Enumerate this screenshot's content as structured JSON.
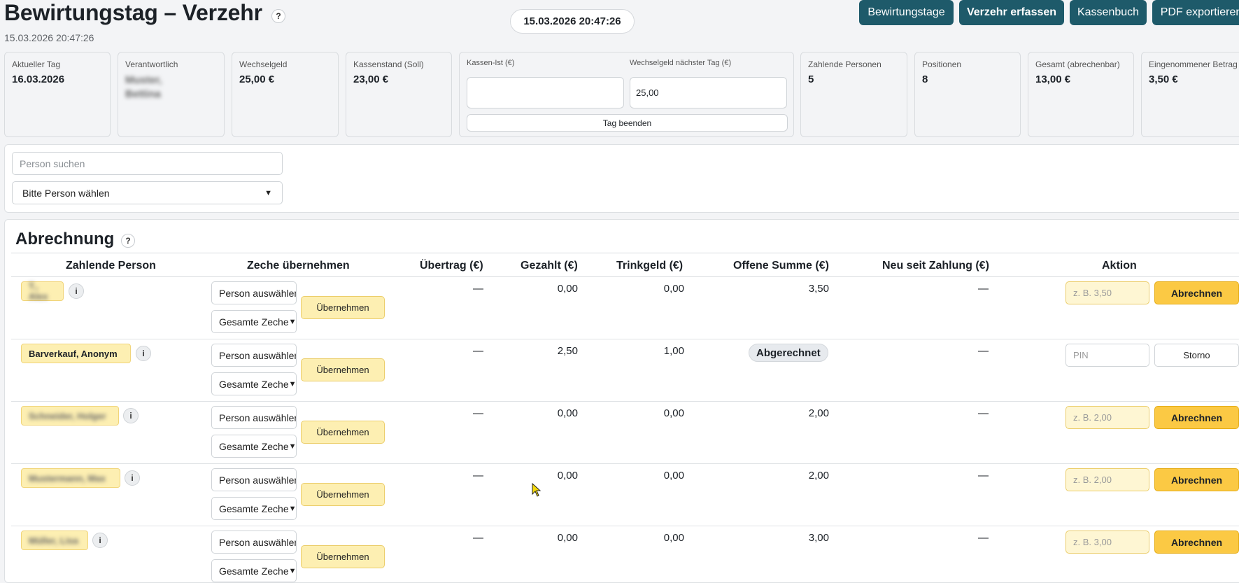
{
  "header": {
    "title": "Bewirtungstag – Verzehr",
    "help": "?",
    "subtitle": "15.03.2026 20:47:26",
    "clock": "15.03.2026 20:47:26",
    "nav": [
      "Bewirtungstage",
      "Verzehr erfassen",
      "Kassenbuch",
      "PDF exportieren"
    ]
  },
  "cards": {
    "current_day": {
      "label": "Aktueller Tag",
      "value": "16.03.2026"
    },
    "responsible": {
      "label": "Verantwortlich",
      "value": "Muster, Bettina"
    },
    "change_money": {
      "label": "Wechselgeld",
      "value": "25,00 €"
    },
    "cash_target": {
      "label": "Kassenstand (Soll)",
      "value": "23,00 €"
    },
    "cash_actual": {
      "label": "Kassen-Ist (€)",
      "value": ""
    },
    "next_change": {
      "label": "Wechselgeld nächster Tag (€)",
      "value": "25,00"
    },
    "end_day": "Tag beenden",
    "paying_persons": {
      "label": "Zahlende Personen",
      "value": "5"
    },
    "positions": {
      "label": "Positionen",
      "value": "8"
    },
    "total": {
      "label": "Gesamt (abrechenbar)",
      "value": "13,00 €"
    },
    "received": {
      "label": "Eingenommener Betrag",
      "value": "3,50 €"
    }
  },
  "search": {
    "placeholder": "Person suchen",
    "select_value": "Bitte Person wählen"
  },
  "billing": {
    "title": "Abrechnung",
    "help": "?",
    "columns": [
      "Zahlende Person",
      "Zeche übernehmen",
      "Übertrag (€)",
      "Gezahlt (€)",
      "Trinkgeld (€)",
      "Offene Summe (€)",
      "Neu seit Zahlung (€)",
      "Aktion"
    ],
    "select_person": "Person auswählen",
    "select_scope": "Gesamte Zeche",
    "take_over": "Übernehmen",
    "info": "i",
    "rows": [
      {
        "name": "T., Alex",
        "transfer": "—",
        "paid": "0,00",
        "tip": "0,00",
        "open": "3,50",
        "new": "—",
        "input": "z. B. 3,50",
        "action": "Abrechnen",
        "settled": false
      },
      {
        "name": "Barverkauf, Anonym",
        "transfer": "—",
        "paid": "2,50",
        "tip": "1,00",
        "open": "Abgerechnet",
        "new": "—",
        "input": "PIN",
        "action": "Storno",
        "settled": true
      },
      {
        "name": "Schneider, Holger",
        "transfer": "—",
        "paid": "0,00",
        "tip": "0,00",
        "open": "2,00",
        "new": "—",
        "input": "z. B. 2,00",
        "action": "Abrechnen",
        "settled": false
      },
      {
        "name": "Mustermann, Max",
        "transfer": "—",
        "paid": "0,00",
        "tip": "0,00",
        "open": "2,00",
        "new": "—",
        "input": "z. B. 2,00",
        "action": "Abrechnen",
        "settled": false
      },
      {
        "name": "Müller, Lisa",
        "transfer": "—",
        "paid": "0,00",
        "tip": "0,00",
        "open": "3,00",
        "new": "—",
        "input": "z. B. 3,00",
        "action": "Abrechnen",
        "settled": false
      }
    ]
  }
}
